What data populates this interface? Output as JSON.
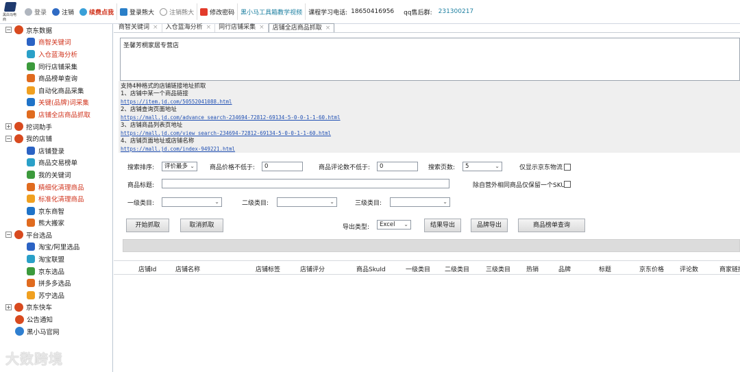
{
  "toolbar": {
    "logo_text": "黑白马电商",
    "login": "登录",
    "logout": "注销",
    "renew": "续费点我",
    "login_xiongda": "登录熊大",
    "logout_xiongda": "注销熊大",
    "change_password": "修改密码",
    "tutorial_link": "黑小马工具箱教学视频",
    "phone_label": "课程学习电话:",
    "phone": "18650416956",
    "qq_label": "qq售后群:",
    "qq": "231300217"
  },
  "sidebar": {
    "groups": [
      {
        "label": "京东数据",
        "expanded": true,
        "items": [
          {
            "label": "商智关键词",
            "hl": true
          },
          {
            "label": "入仓蓝海分析",
            "hl": true
          },
          {
            "label": "同行店铺采集",
            "hl": false
          },
          {
            "label": "商品榜单查询",
            "hl": false
          },
          {
            "label": "自动化商品采集",
            "hl": false
          },
          {
            "label": "关键(品牌)词采集",
            "hl": true
          },
          {
            "label": "店铺全店商品抓取",
            "hl": true
          }
        ]
      },
      {
        "label": "挖词助手",
        "expanded": false,
        "items": []
      },
      {
        "label": "我的店铺",
        "expanded": true,
        "items": [
          {
            "label": "店铺登录",
            "hl": false
          },
          {
            "label": "商品交易榜单",
            "hl": false
          },
          {
            "label": "我的关键词",
            "hl": false
          },
          {
            "label": "精细化清理商品",
            "hl": true
          },
          {
            "label": "标准化清理商品",
            "hl": true
          },
          {
            "label": "京东商智",
            "hl": false
          },
          {
            "label": "熊大搬家",
            "hl": false
          }
        ]
      },
      {
        "label": "平台选品",
        "expanded": true,
        "items": [
          {
            "label": "淘宝/阿里选品",
            "hl": false
          },
          {
            "label": "淘宝联盟",
            "hl": false
          },
          {
            "label": "京东选品",
            "hl": false
          },
          {
            "label": "拼多多选品",
            "hl": false
          },
          {
            "label": "苏宁选品",
            "hl": false
          }
        ]
      },
      {
        "label": "京东快车",
        "expanded": false,
        "items": []
      },
      {
        "label": "公告通知",
        "expanded": null,
        "items": []
      },
      {
        "label": "黑小马官网",
        "expanded": null,
        "items": []
      }
    ]
  },
  "tabs": [
    {
      "label": "商智关键词"
    },
    {
      "label": "入仓蓝海分析"
    },
    {
      "label": "同行店铺采集"
    },
    {
      "label": "店铺全店商品抓取"
    }
  ],
  "store_input": "圣馨芳桐家居专营店",
  "info": {
    "title": "支持4种格式的店铺链接地址抓取",
    "f1": "1、店铺中某一个商品链接",
    "u1": "https://item.jd.com/50552041088.html",
    "f2": "2、店铺查询页面地址",
    "u2": "https://mall.jd.com/advance_search-234694-72812-69134-5-0-0-1-1-60.html",
    "f3": "3、店铺商品列表页地址",
    "u3": "https://mall.jd.com/view_search-234694-72812-69134-5-0-0-1-1-60.html",
    "f4": "4、店铺页面地址或店铺名称",
    "u4": "https://mall.jd.com/index-949221.html"
  },
  "form": {
    "sort_label": "搜索排序:",
    "sort_value": "评价最多",
    "price_label": "商品价格不低于:",
    "price_value": "0",
    "reviews_label": "商品评论数不低于:",
    "reviews_value": "0",
    "pages_label": "搜索页数:",
    "pages_value": "5",
    "jd_logistics_label": "仅显示京东物流",
    "title_label": "商品标题:",
    "title_value": "",
    "dedupe_label": "除自营外相同商品仅保留一个SKU",
    "cat1_label": "一级类目:",
    "cat2_label": "二级类目:",
    "cat3_label": "三级类目:",
    "export_type_label": "导出类型:",
    "export_type_value": "Excel"
  },
  "buttons": {
    "start": "开始抓取",
    "cancel": "取消抓取",
    "export_results": "结果导出",
    "export_brands": "品牌导出",
    "ranking_query": "商品榜单查询"
  },
  "table_columns": [
    "店铺Id",
    "店铺名称",
    "店铺标签",
    "店铺评分",
    "商品SkuId",
    "一级类目",
    "二级类目",
    "三级类目",
    "热销",
    "品牌",
    "标题",
    "京东价格",
    "评论数",
    "商家链接"
  ],
  "watermark": "大数跨境"
}
